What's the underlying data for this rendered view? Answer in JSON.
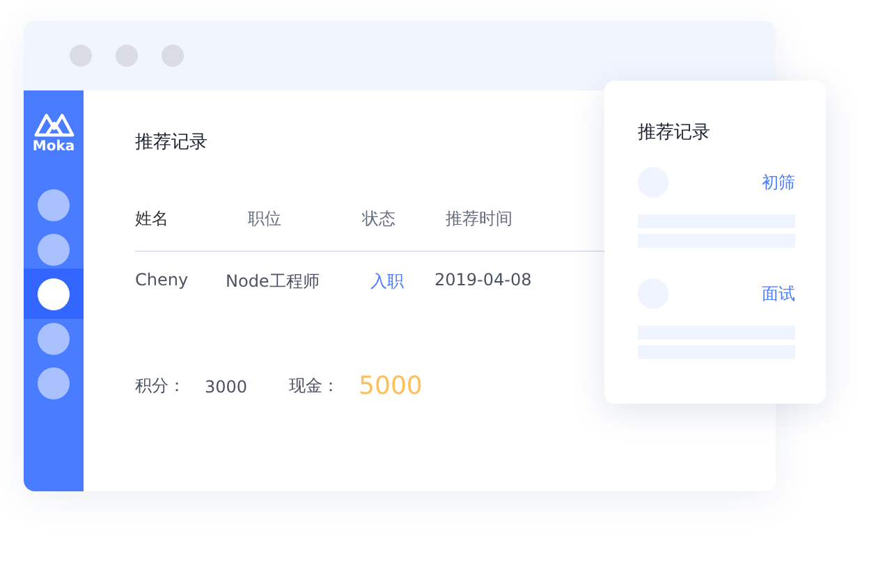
{
  "sidebar": {
    "logo": "Moka",
    "items": [
      {
        "selected": false
      },
      {
        "selected": false
      },
      {
        "selected": true
      },
      {
        "selected": false
      },
      {
        "selected": false
      }
    ]
  },
  "main": {
    "title": "推荐记录",
    "table": {
      "columns": [
        "姓名",
        "职位",
        "状态",
        "推荐时间"
      ],
      "rows": [
        [
          "Cheny",
          "Node工程师",
          "入职",
          "2019-04-08"
        ]
      ]
    },
    "points_label": "积分：",
    "points": "3000",
    "cash_label": "现金：",
    "cash": "5000"
  },
  "card": {
    "title": "推荐记录",
    "entries": [
      {
        "status": "初筛"
      },
      {
        "status": "面试"
      }
    ]
  }
}
